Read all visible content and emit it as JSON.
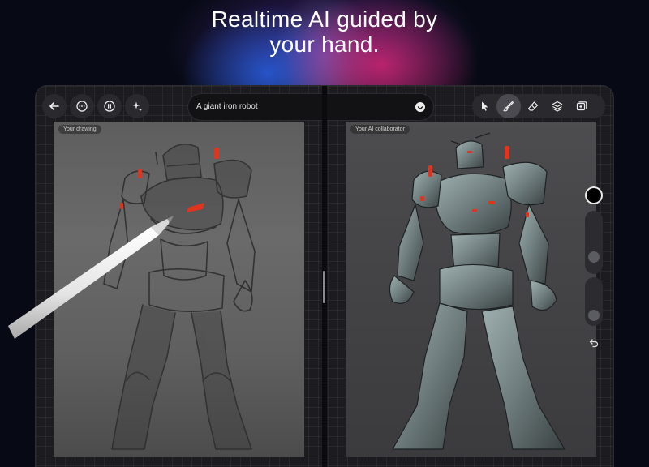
{
  "headline": {
    "line1": "Realtime AI guided by",
    "line2": "your hand."
  },
  "toolbar": {
    "left_icons": [
      "back-arrow-icon",
      "more-options-icon",
      "pause-icon",
      "sparkle-icon"
    ],
    "prompt": {
      "value": "A giant iron robot",
      "chevron_icon": "chevron-down-icon"
    },
    "right_icons": [
      "select-cursor-icon",
      "brush-icon",
      "eraser-icon",
      "layers-icon",
      "add-image-icon"
    ],
    "active_tool": "brush-icon"
  },
  "panes": {
    "left_label": "Your drawing",
    "right_label": "Your AI collaborator"
  },
  "side_tools": {
    "current_color": "#000000",
    "undo_icon": "undo-icon"
  },
  "colors": {
    "accent_red": "#e0341f",
    "background": "#070a14",
    "canvas_frame": "#1c1c20"
  }
}
